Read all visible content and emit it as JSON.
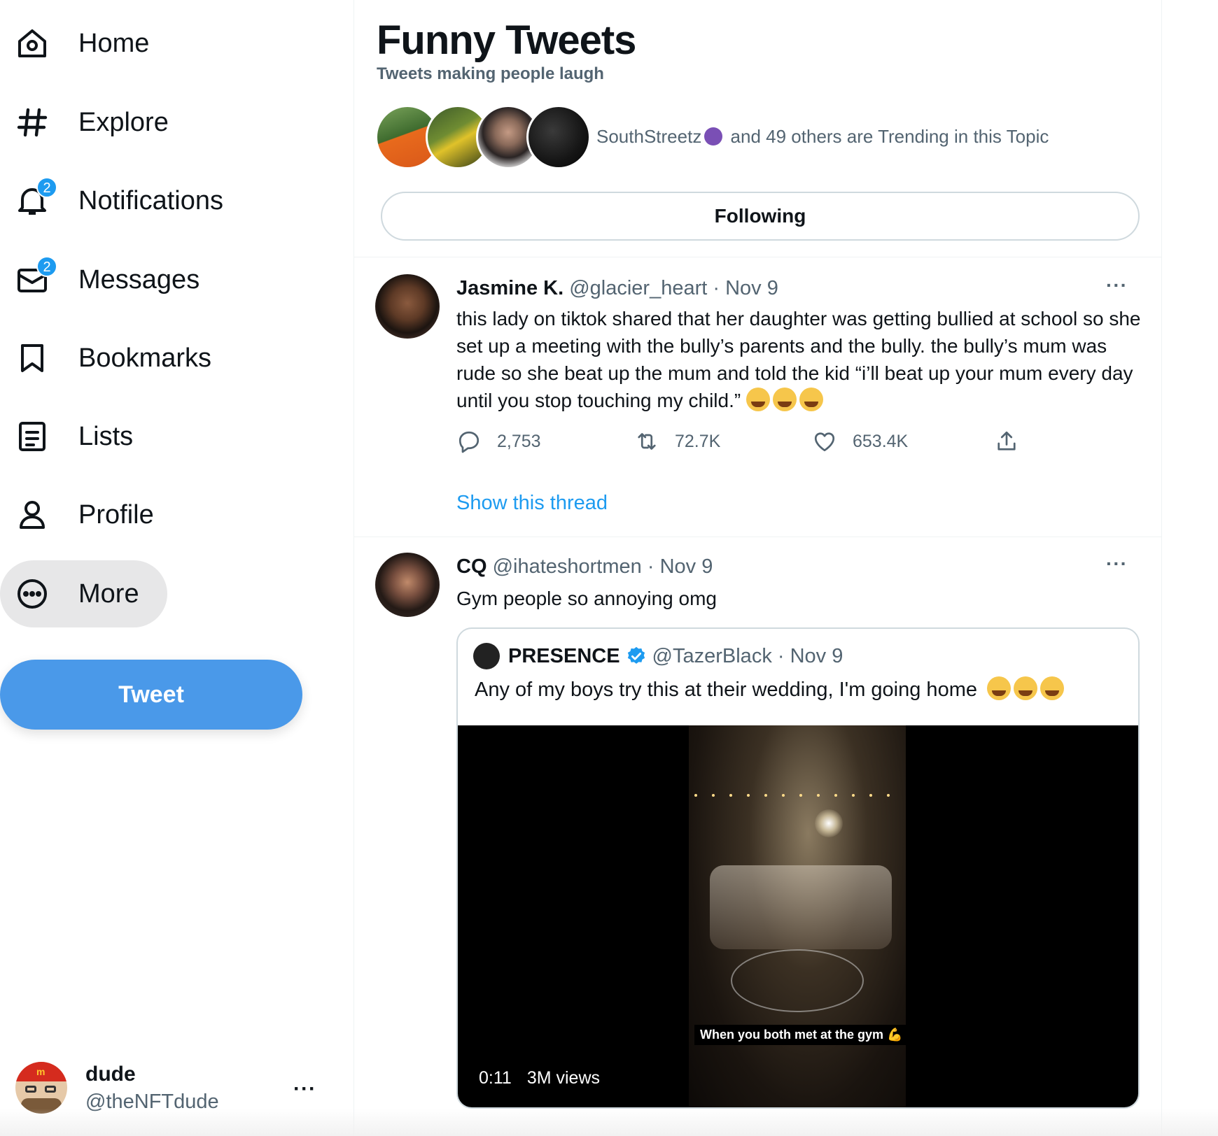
{
  "sidebar": {
    "items": [
      {
        "label": "Home",
        "icon": "home-icon"
      },
      {
        "label": "Explore",
        "icon": "hashtag-icon"
      },
      {
        "label": "Notifications",
        "icon": "bell-icon",
        "badge": "2"
      },
      {
        "label": "Messages",
        "icon": "envelope-icon",
        "badge": "2"
      },
      {
        "label": "Bookmarks",
        "icon": "bookmark-icon"
      },
      {
        "label": "Lists",
        "icon": "list-icon"
      },
      {
        "label": "Profile",
        "icon": "person-icon"
      },
      {
        "label": "More",
        "icon": "more-circle-icon",
        "active": true
      }
    ],
    "tweet_button": "Tweet",
    "account": {
      "name": "dude",
      "handle": "@theNFTdude",
      "more": "···"
    }
  },
  "topic": {
    "title": "Funny Tweets",
    "subtitle": "Tweets making people laugh",
    "trending_name": "SouthStreetz",
    "trending_rest": "and 49 others are Trending in this Topic",
    "follow_label": "Following"
  },
  "tweets": [
    {
      "name": "Jasmine K.",
      "handle": "@glacier_heart",
      "date": "Nov 9",
      "text": "this lady on tiktok shared that her daughter was getting bullied at school so she set up a meeting with the bully’s parents and the bully. the bully’s mum was rude so she beat up the mum and told the kid “i’ll beat up your mum every day until you stop touching my child.”",
      "replies": "2,753",
      "retweets": "72.7K",
      "likes": "653.4K",
      "show_thread": "Show this thread",
      "more": "···"
    },
    {
      "name": "CQ",
      "handle": "@ihateshortmen",
      "date": "Nov 9",
      "text": "Gym people so annoying omg",
      "more": "···",
      "quote": {
        "name": "PRESENCE",
        "handle": "@TazerBlack",
        "date": "Nov 9",
        "text": "Any of my boys try this at their wedding, I'm going home",
        "video_caption": "When you both met at the gym 💪",
        "duration": "0:11",
        "views": "3M views"
      }
    }
  ],
  "colors": {
    "accent": "#1d9bf0",
    "tweet_button": "#4a99e9",
    "muted": "#536471"
  }
}
